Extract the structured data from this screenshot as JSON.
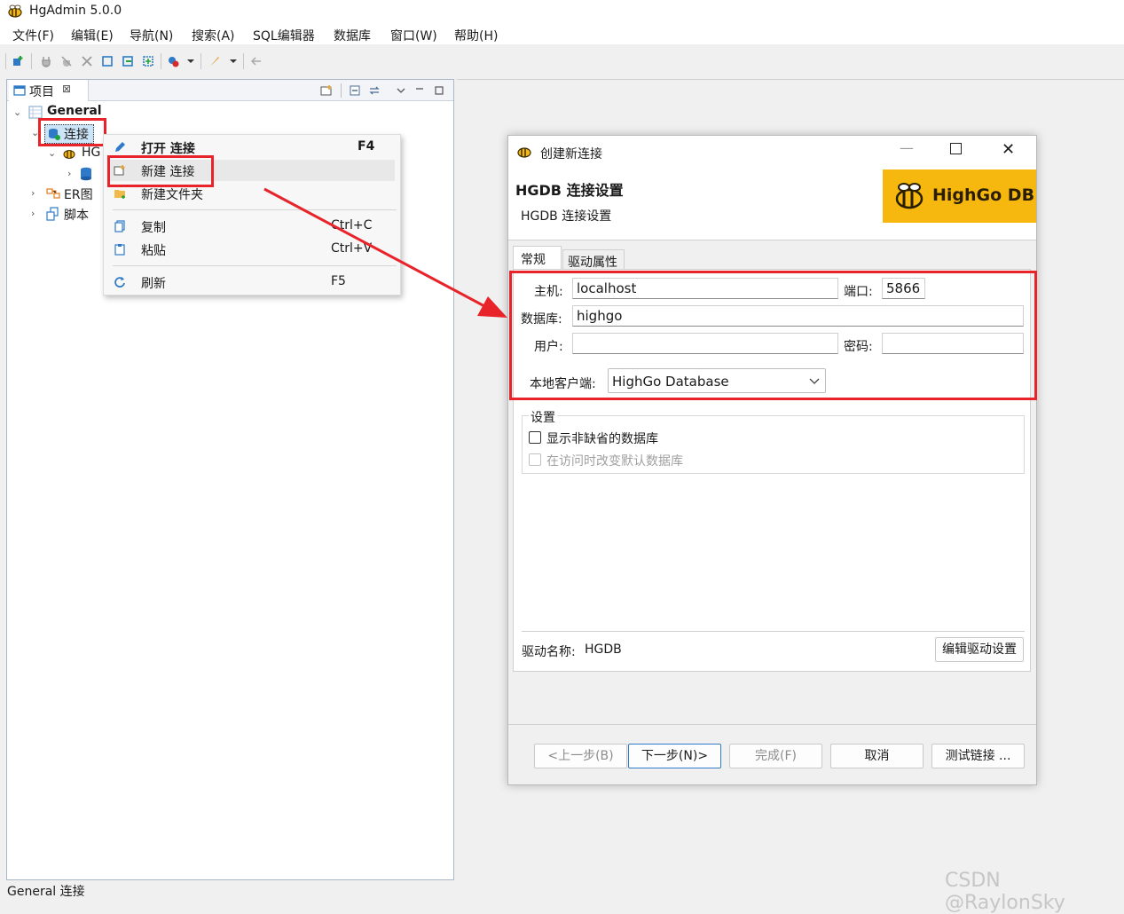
{
  "window": {
    "title": "HgAdmin 5.0.0"
  },
  "menubar": {
    "items": [
      "文件(F)",
      "编辑(E)",
      "导航(N)",
      "搜索(A)",
      "SQL编辑器",
      "数据库",
      "窗口(W)",
      "帮助(H)"
    ]
  },
  "project_view": {
    "tab_label": "项目",
    "tree": {
      "root": "General",
      "connections": "连接",
      "hg_node": "HG",
      "er": "ER图",
      "scripts": "脚本"
    }
  },
  "context_menu": {
    "items": [
      {
        "label": "打开 连接",
        "accel": "F4",
        "bold": true,
        "icon": "pencil-icon"
      },
      {
        "label": "新建 连接",
        "accel": "",
        "icon": "new-connection-icon",
        "highlighted": true
      },
      {
        "label": "新建文件夹",
        "accel": "",
        "icon": "new-folder-icon"
      },
      {
        "label": "复制",
        "accel": "Ctrl+C",
        "icon": "copy-icon"
      },
      {
        "label": "粘贴",
        "accel": "Ctrl+V",
        "icon": "paste-icon"
      },
      {
        "label": "刷新",
        "accel": "F5",
        "icon": "refresh-icon"
      }
    ]
  },
  "dialog": {
    "title": "创建新连接",
    "header_title": "HGDB 连接设置",
    "header_subtitle": "HGDB 连接设置",
    "logo_text": "HighGo DB",
    "tabs": [
      "常规",
      "驱动属性"
    ],
    "host_label": "主机:",
    "host_value": "localhost",
    "port_label": "端口:",
    "port_value": "5866",
    "database_label": "数据库:",
    "database_value": "highgo",
    "user_label": "用户:",
    "user_value": "",
    "password_label": "密码:",
    "password_value": "",
    "client_label": "本地客户端:",
    "client_value": "HighGo Database",
    "settings_group": "设置",
    "checkbox_show_nondefault": "显示非缺省的数据库",
    "checkbox_change_default": "在访问时改变默认数据库",
    "driver_label": "驱动名称:",
    "driver_value": "HGDB",
    "edit_driver_button": "编辑驱动设置",
    "buttons": {
      "back": "<上一步(B)",
      "next": "下一步(N)>",
      "finish": "完成(F)",
      "cancel": "取消",
      "test": "测试链接 ..."
    }
  },
  "statusbar": {
    "text": "General 连接"
  },
  "watermark": "CSDN @RaylonSky",
  "colors": {
    "accent_red": "#e8232a",
    "logo_bg": "#f6b80e",
    "selection": "#cce4f7"
  }
}
